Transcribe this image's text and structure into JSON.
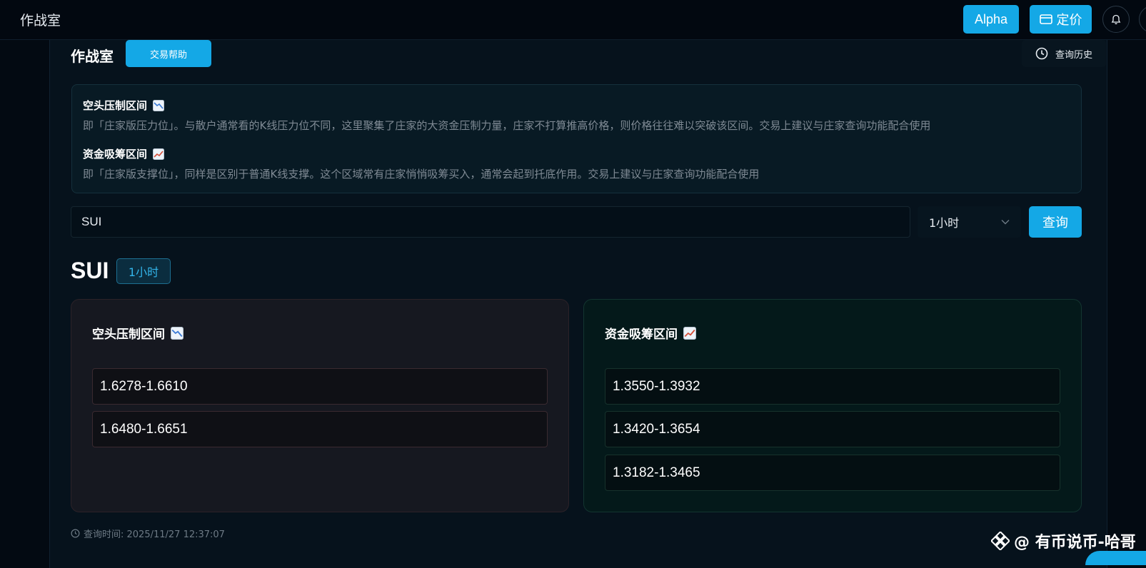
{
  "header": {
    "app_title": "作战室",
    "alpha_label": "Alpha",
    "pricing_label": "定价"
  },
  "panel": {
    "title": "作战室",
    "help_label": "交易帮助",
    "history_label": "查询历史"
  },
  "info": {
    "short_title": "空头压制区间",
    "short_desc": "即「庄家版压力位」。与散户通常看的K线压力位不同，这里聚集了庄家的大资金压制力量，庄家不打算推高价格，则价格往往难以突破该区间。交易上建议与庄家查询功能配合使用",
    "long_title": "资金吸筹区间",
    "long_desc": "即「庄家版支撑位」，同样是区别于普通K线支撑。这个区域常有庄家悄悄吸筹买入，通常会起到托底作用。交易上建议与庄家查询功能配合使用"
  },
  "search": {
    "value": "SUI",
    "timeframe": "1小时",
    "query_label": "查询"
  },
  "result": {
    "symbol": "SUI",
    "timeframe": "1小时",
    "short_card": {
      "title": "空头压制区间",
      "ranges": [
        "1.6278-1.6610",
        "1.6480-1.6651"
      ]
    },
    "long_card": {
      "title": "资金吸筹区间",
      "ranges": [
        "1.3550-1.3932",
        "1.3420-1.3654",
        "1.3182-1.3465"
      ]
    },
    "query_time": "查询时间: 2025/11/27 12:37:07"
  },
  "watermark": {
    "text": "@ 有币说币-哈哥"
  },
  "colors": {
    "accent": "#14a8e6",
    "bg": "#030a12",
    "short_card_bg": "#161820",
    "long_card_bg": "#04191a"
  }
}
